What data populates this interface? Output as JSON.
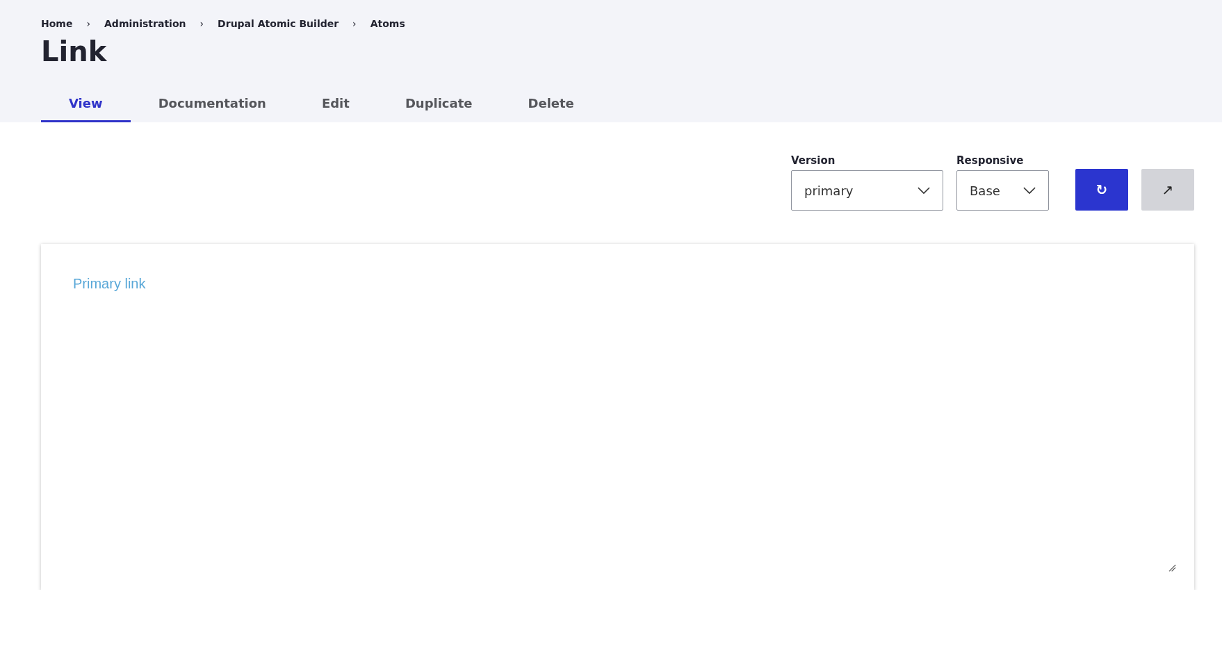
{
  "breadcrumb": [
    {
      "label": "Home"
    },
    {
      "label": "Administration"
    },
    {
      "label": "Drupal Atomic Builder"
    },
    {
      "label": "Atoms"
    }
  ],
  "breadcrumb_separator": "›",
  "page_title": "Link",
  "tabs": [
    {
      "label": "View",
      "selected": true
    },
    {
      "label": "Documentation",
      "selected": false
    },
    {
      "label": "Edit",
      "selected": false
    },
    {
      "label": "Duplicate",
      "selected": false
    },
    {
      "label": "Delete",
      "selected": false
    }
  ],
  "controls": {
    "version": {
      "label": "Version",
      "value": "primary"
    },
    "responsive": {
      "label": "Responsive",
      "value": "Base"
    },
    "refresh_button": "↻",
    "open_button": "↗"
  },
  "preview": {
    "link_text": "Primary link"
  }
}
